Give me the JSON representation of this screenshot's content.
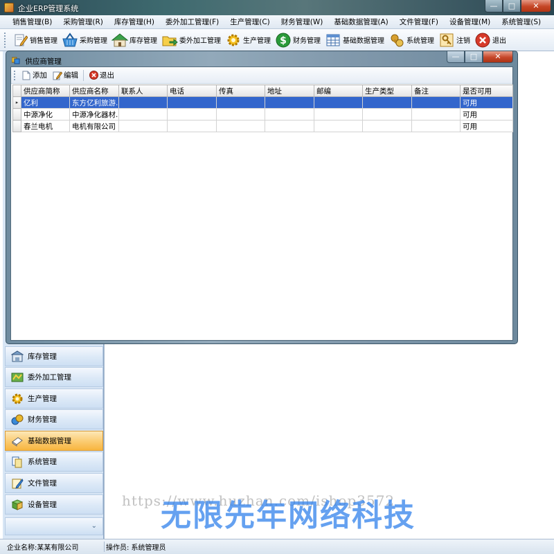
{
  "window": {
    "title": "企业ERP管理系统",
    "minimize": "—",
    "maximize": "□",
    "close": "✕"
  },
  "menubar": [
    "销售管理(B)",
    "采购管理(R)",
    "库存管理(H)",
    "委外加工管理(F)",
    "生产管理(C)",
    "财务管理(W)",
    "基础数据管理(A)",
    "文件管理(F)",
    "设备管理(M)",
    "系统管理(S)"
  ],
  "toolbar": [
    {
      "label": "销售管理",
      "icon": "pencil-icon"
    },
    {
      "label": "采购管理",
      "icon": "basket-icon"
    },
    {
      "label": "库存管理",
      "icon": "house-icon"
    },
    {
      "label": "委外加工管理",
      "icon": "folder-arrow-icon"
    },
    {
      "label": "生产管理",
      "icon": "gear-icon"
    },
    {
      "label": "财务管理",
      "icon": "dollar-icon"
    },
    {
      "label": "基础数据管理",
      "icon": "table-icon"
    },
    {
      "label": "系统管理",
      "icon": "tools-icon"
    },
    {
      "label": "注销",
      "icon": "key-icon"
    },
    {
      "label": "退出",
      "icon": "close-circle-icon"
    }
  ],
  "leftnav": {
    "items": [
      {
        "label": "库存管理",
        "active": false
      },
      {
        "label": "委外加工管理",
        "active": false
      },
      {
        "label": "生产管理",
        "active": false
      },
      {
        "label": "财务管理",
        "active": false
      },
      {
        "label": "基础数据管理",
        "active": true
      },
      {
        "label": "系统管理",
        "active": false
      },
      {
        "label": "文件管理",
        "active": false
      },
      {
        "label": "设备管理",
        "active": false
      }
    ],
    "footer_glyph": "⌄"
  },
  "dialog": {
    "title": "供应商管理",
    "toolbar": {
      "add": "添加",
      "edit": "编辑",
      "exit": "退出"
    },
    "grid": {
      "columns": [
        "供应商简称",
        "供应商名称",
        "联系人",
        "电话",
        "传真",
        "地址",
        "邮编",
        "生产类型",
        "备注",
        "是否可用"
      ],
      "rows": [
        {
          "cells": [
            "亿利",
            "东方亿利旅游...",
            "",
            "",
            "",
            "",
            "",
            "",
            "",
            "可用"
          ],
          "selected": true
        },
        {
          "cells": [
            "中源净化",
            "中源净化器材...",
            "",
            "",
            "",
            "",
            "",
            "",
            "",
            "可用"
          ],
          "selected": false
        },
        {
          "cells": [
            "春兰电机",
            "电机有限公司",
            "",
            "",
            "",
            "",
            "",
            "",
            "",
            "可用"
          ],
          "selected": false
        }
      ],
      "row_indicator": "▸"
    }
  },
  "statusbar": {
    "company": "企业名称:某某有限公司",
    "operator": "操作员: 系统管理员"
  },
  "watermark": {
    "url": "https://www.huzhan.com/ishop3572",
    "text": "无限先年网络科技"
  },
  "colors": {
    "selection": "#3366cc",
    "active_nav": "#f8b53f",
    "close_button": "#c54626"
  }
}
